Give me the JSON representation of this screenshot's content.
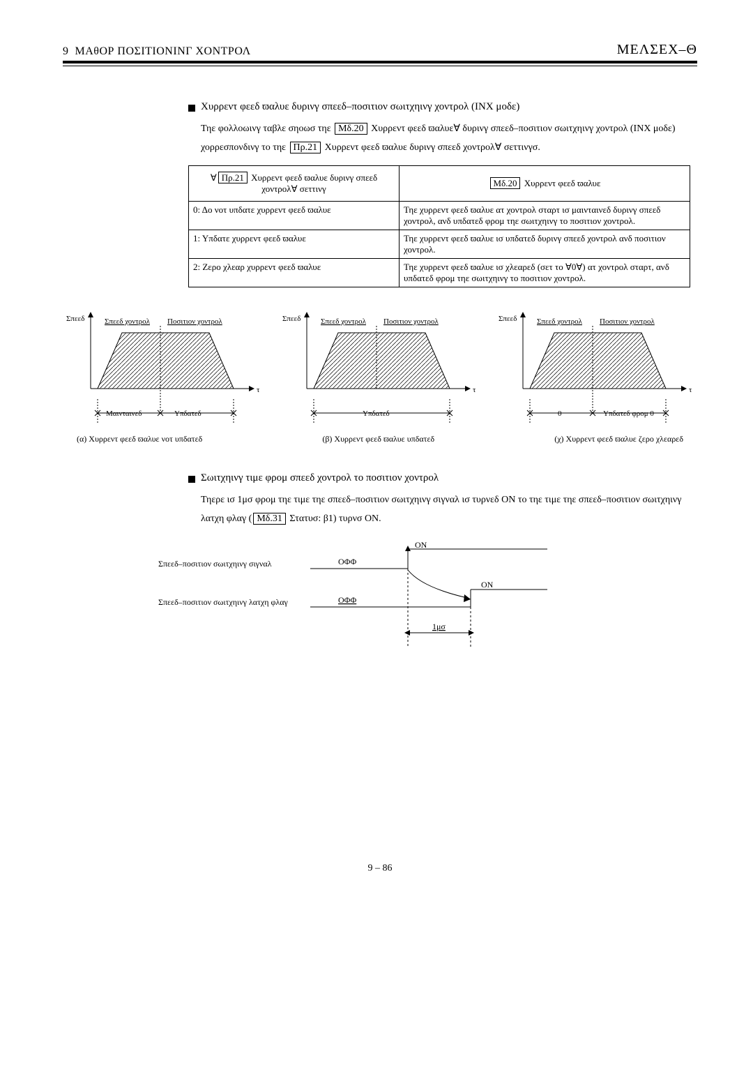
{
  "header": {
    "section_num": "9",
    "section_title": "ΜΑθΟΡ ΠΟΣΙΤΙΟΝΙΝΓ ΧΟΝΤΡΟΛ",
    "brand": "ΜΕΛΣΕΧ–Θ"
  },
  "block1": {
    "title": "Χυρρεντ φεεδ ϖαλυε δυρινγ σπεεδ–ποσιτιον σωιτχηινγ χοντρολ (ΙΝΧ μοδε)",
    "para_pre": "Τηε φολλοωινγ ταβλε σηοωσ τηε",
    "box1": "Μδ.20",
    "para_mid1": " Χυρρεντ φεεδ ϖαλυε∀ δυρινγ σπεεδ–ποσιτιον σωιτχηινγ χοντρολ (ΙΝΧ μοδε) χορρεσπονδινγ το τηε ",
    "box2": "Πρ.21",
    "para_mid2": " Χυρρεντ φεεδ ϖαλυε δυρινγ σπεεδ χοντρολ∀ σεττινγσ."
  },
  "table": {
    "head_col1_pre": "∀",
    "head_col1_box": "Πρ.21",
    "head_col1_post": " Χυρρεντ φεεδ ϖαλυε δυρινγ σπεεδ χοντρολ∀ σεττινγ",
    "head_col2_box": "Μδ.20",
    "head_col2_post": " Χυρρεντ φεεδ ϖαλυε",
    "rows": [
      {
        "c1": "0: Δο νοτ υπδατε χυρρεντ φεεδ ϖαλυε",
        "c2": "Τηε χυρρεντ φεεδ ϖαλυε ατ χοντρολ σταρτ ισ μαινταινεδ δυρινγ σπεεδ χοντρολ, ανδ υπδατεδ φρομ τηε σωιτχηινγ το ποσιτιον χοντρολ."
      },
      {
        "c1": "1: Υπδατε χυρρεντ φεεδ ϖαλυε",
        "c2": "Τηε χυρρεντ φεεδ ϖαλυε ισ υπδατεδ δυρινγ σπεεδ χοντρολ ανδ ποσιτιον χοντρολ."
      },
      {
        "c1": "2: Ζερο χλεαρ χυρρεντ φεεδ ϖαλυε",
        "c2": "Τηε χυρρεντ φεεδ ϖαλυε ισ χλεαρεδ (σετ το ∀0∀) ατ χοντρολ σταρτ, ανδ υπδατεδ φρομ τηε σωιτχηινγ το ποσιτιον χοντρολ."
      }
    ]
  },
  "diag_labels": {
    "speed": "Σπεεδ",
    "speed_control": "Σπεεδ χοντρολ",
    "position_control": "Ποσιτιον χοντρολ",
    "t": "τ",
    "maintained": "Μαινταινεδ",
    "updated": "Υπδατεδ",
    "zero": "0",
    "updated_from_0": "Υπδατεδ φρομ 0"
  },
  "captions": {
    "a": "(α) Χυρρεντ φεεδ ϖαλυε νοτ υπδατεδ",
    "b": "(β) Χυρρεντ φεεδ ϖαλυε υπδατεδ",
    "c": "(χ) Χυρρεντ φεεδ ϖαλυε ζερο χλεαρεδ"
  },
  "block2": {
    "title": "Σωιτχηινγ τιμε φρομ σπεεδ χοντρολ το ποσιτιον χοντρολ",
    "para_pre": "Τηερε ισ 1μσ φρομ τηε τιμε τηε σπεεδ–ποσιτιον σωιτχηινγ σιγναλ ισ τυρνεδ ΟΝ το τηε τιμε τηε σπεεδ–ποσιτιον σωιτχηινγ λατχη φλαγ (",
    "box": "Μδ.31",
    "para_post": " Στατυσ: β1) τυρνσ ΟΝ."
  },
  "timing": {
    "label1": "Σπεεδ–ποσιτιον σωιτχηινγ σιγναλ",
    "label2": "Σπεεδ–ποσιτιον σωιτχηινγ λατχη φλαγ",
    "off": "ΟΦΦ",
    "on": "ΟΝ",
    "one_ms": "1μσ"
  },
  "page_num": "9 – 86"
}
